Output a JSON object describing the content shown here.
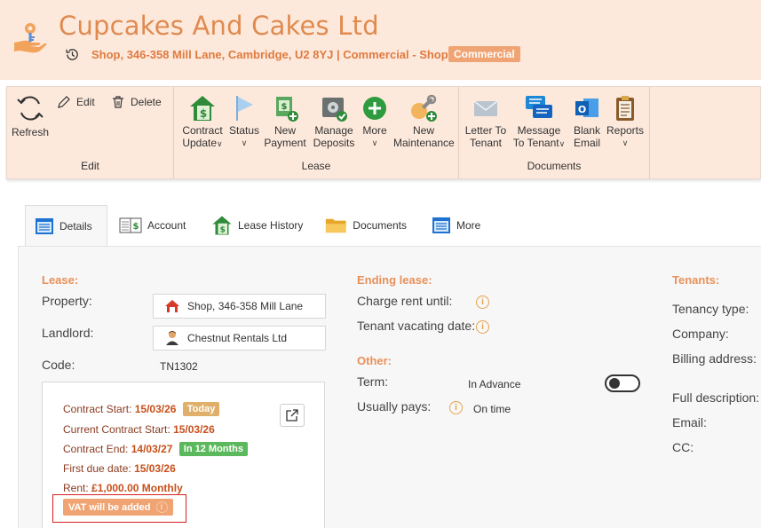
{
  "header": {
    "title": "Cupcakes And Cakes Ltd",
    "subtitle": "Shop, 346-358 Mill Lane, Cambridge, U2 8YJ | Commercial - Shop |",
    "badge": "Commercial",
    "logo_icon": "hand-key-icon",
    "history_icon": "history-icon"
  },
  "ribbon": {
    "groups": {
      "edit": "Edit",
      "lease": "Lease",
      "documents": "Documents"
    },
    "buttons": {
      "refresh": "Refresh",
      "edit": "Edit",
      "delete": "Delete",
      "contract_update_1": "Contract",
      "contract_update_2": "Update",
      "status": "Status",
      "new_payment_1": "New",
      "new_payment_2": "Payment",
      "manage_deposits_1": "Manage",
      "manage_deposits_2": "Deposits",
      "more": "More",
      "new_maintenance_1": "New",
      "new_maintenance_2": "Maintenance",
      "letter_1": "Letter To",
      "letter_2": "Tenant",
      "message_1": "Message",
      "message_2": "To Tenant",
      "blank_email_1": "Blank",
      "blank_email_2": "Email",
      "reports": "Reports"
    }
  },
  "tabs": [
    {
      "label": "Details",
      "icon": "details-icon"
    },
    {
      "label": "Account",
      "icon": "ledger-icon"
    },
    {
      "label": "Lease History",
      "icon": "house-dollar-icon"
    },
    {
      "label": "Documents",
      "icon": "folder-icon"
    },
    {
      "label": "More",
      "icon": "list-icon"
    }
  ],
  "lease": {
    "heading": "Lease:",
    "property_label": "Property:",
    "property_value": "Shop, 346-358 Mill Lane",
    "landlord_label": "Landlord:",
    "landlord_value": "Chestnut Rentals Ltd",
    "code_label": "Code:",
    "code_value": "TN1302"
  },
  "contract": {
    "start_label": "Contract Start:",
    "start_value": "15/03/26",
    "start_badge": "Today",
    "current_label": "Current Contract Start:",
    "current_value": "15/03/26",
    "end_label": "Contract End:",
    "end_value": "14/03/27",
    "end_badge": "In 12 Months",
    "first_due_label": "First due date:",
    "first_due_value": "15/03/26",
    "rent_label": "Rent:",
    "rent_value": "£1,000.00",
    "rent_freq": "Monthly",
    "vat": "VAT will be added",
    "colors": {
      "today_badge": "#e0b06a",
      "months_badge": "#5cb85c",
      "vat_badge": "#f0a473"
    }
  },
  "ending_lease": {
    "heading": "Ending lease:",
    "charge_label": "Charge rent until:",
    "vacating_label": "Tenant vacating date:"
  },
  "other": {
    "heading": "Other:",
    "term_label": "Term:",
    "term_value": "In Advance",
    "pays_label": "Usually pays:",
    "pays_value": "On time"
  },
  "tenants": {
    "heading": "Tenants:",
    "tenancy_type": "Tenancy type:",
    "company": "Company:",
    "billing": "Billing address:",
    "full_desc": "Full description:",
    "email": "Email:",
    "cc": "CC:"
  }
}
